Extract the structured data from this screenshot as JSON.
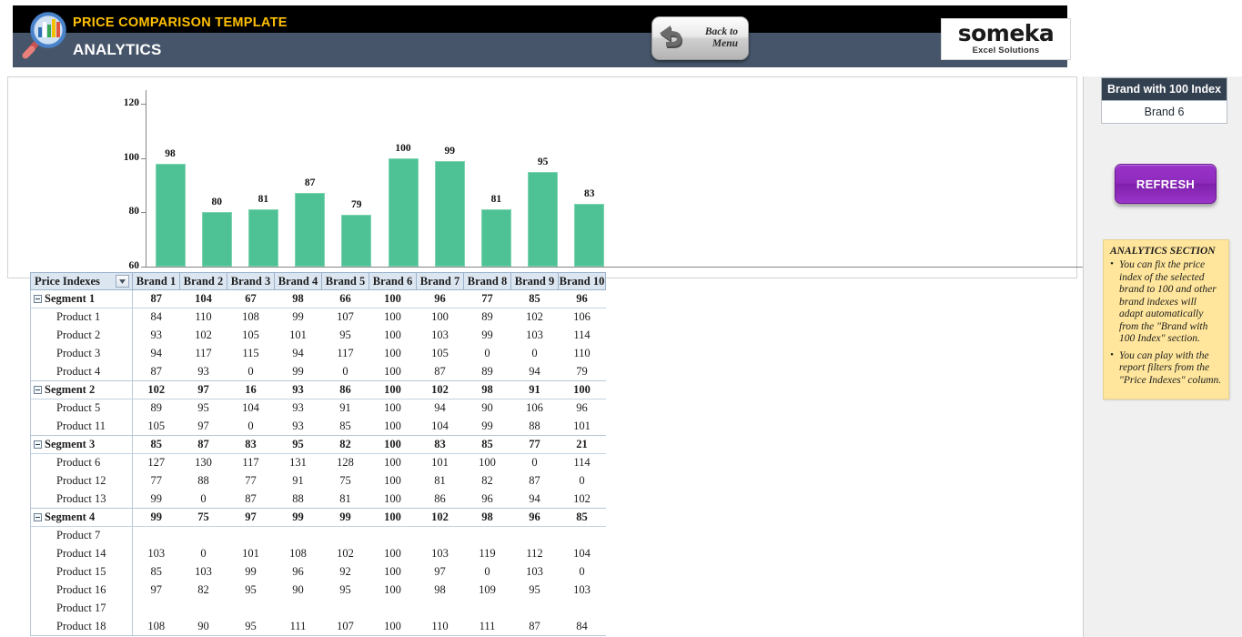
{
  "header": {
    "title": "PRICE COMPARISON TEMPLATE",
    "subtitle": "ANALYTICS",
    "back_button": {
      "line1": "Back to",
      "line2": "Menu"
    },
    "brand_logo": {
      "name": "someka",
      "tagline": "Excel Solutions"
    }
  },
  "chart_data": {
    "type": "bar",
    "title": "",
    "xlabel": "",
    "ylabel": "",
    "categories": [
      "Brand 1",
      "Brand 2",
      "Brand 3",
      "Brand 4",
      "Brand 5",
      "Brand 6",
      "Brand 7",
      "Brand 8",
      "Brand 9",
      "Brand 10"
    ],
    "values": [
      98,
      80,
      81,
      87,
      79,
      100,
      99,
      81,
      95,
      83
    ],
    "ylim": [
      60,
      125
    ],
    "yticks": [
      60,
      80,
      100,
      120
    ],
    "grid": false,
    "legend": false,
    "bar_color": "#4fc295"
  },
  "pivot": {
    "filter_header": "Price Indexes",
    "columns": [
      "Brand 1",
      "Brand 2",
      "Brand 3",
      "Brand 4",
      "Brand 5",
      "Brand 6",
      "Brand 7",
      "Brand 8",
      "Brand 9",
      "Brand 10"
    ],
    "rows": [
      {
        "type": "segment",
        "label": "Segment 1",
        "values": [
          87,
          104,
          67,
          98,
          66,
          100,
          96,
          77,
          85,
          96
        ]
      },
      {
        "type": "product",
        "label": "Product 1",
        "values": [
          84,
          110,
          108,
          99,
          107,
          100,
          100,
          89,
          102,
          106
        ]
      },
      {
        "type": "product",
        "label": "Product 2",
        "values": [
          93,
          102,
          105,
          101,
          95,
          100,
          103,
          99,
          103,
          114
        ]
      },
      {
        "type": "product",
        "label": "Product 3",
        "values": [
          94,
          117,
          115,
          94,
          117,
          100,
          105,
          0,
          0,
          110
        ]
      },
      {
        "type": "product",
        "label": "Product 4",
        "values": [
          87,
          93,
          0,
          99,
          0,
          100,
          87,
          89,
          94,
          79
        ]
      },
      {
        "type": "segment",
        "label": "Segment 2",
        "values": [
          102,
          97,
          16,
          93,
          86,
          100,
          102,
          98,
          91,
          100
        ]
      },
      {
        "type": "product",
        "label": "Product 5",
        "values": [
          89,
          95,
          104,
          93,
          91,
          100,
          94,
          90,
          106,
          96
        ]
      },
      {
        "type": "product",
        "label": "Product 11",
        "values": [
          105,
          97,
          0,
          93,
          85,
          100,
          104,
          99,
          88,
          101
        ]
      },
      {
        "type": "segment",
        "label": "Segment 3",
        "values": [
          85,
          87,
          83,
          95,
          82,
          100,
          83,
          85,
          77,
          21
        ]
      },
      {
        "type": "product",
        "label": "Product 6",
        "values": [
          127,
          130,
          117,
          131,
          128,
          100,
          101,
          100,
          0,
          114
        ]
      },
      {
        "type": "product",
        "label": "Product 12",
        "values": [
          77,
          88,
          77,
          91,
          75,
          100,
          81,
          82,
          87,
          0
        ]
      },
      {
        "type": "product",
        "label": "Product 13",
        "values": [
          99,
          0,
          87,
          88,
          81,
          100,
          86,
          96,
          94,
          102
        ]
      },
      {
        "type": "segment",
        "label": "Segment 4",
        "values": [
          99,
          75,
          97,
          99,
          99,
          100,
          102,
          98,
          96,
          85
        ]
      },
      {
        "type": "product",
        "label": "Product 7",
        "values": [
          "",
          "",
          "",
          "",
          "",
          "",
          "",
          "",
          "",
          ""
        ]
      },
      {
        "type": "product",
        "label": "Product 14",
        "values": [
          103,
          0,
          101,
          108,
          102,
          100,
          103,
          119,
          112,
          104
        ]
      },
      {
        "type": "product",
        "label": "Product 15",
        "values": [
          85,
          103,
          99,
          96,
          92,
          100,
          97,
          0,
          103,
          0
        ]
      },
      {
        "type": "product",
        "label": "Product 16",
        "values": [
          97,
          82,
          95,
          90,
          95,
          100,
          98,
          109,
          95,
          103
        ]
      },
      {
        "type": "product",
        "label": "Product 17",
        "values": [
          "",
          "",
          "",
          "",
          "",
          "",
          "",
          "",
          "",
          ""
        ]
      },
      {
        "type": "product",
        "label": "Product 18",
        "values": [
          108,
          90,
          95,
          111,
          107,
          100,
          110,
          111,
          87,
          84
        ]
      }
    ]
  },
  "right_panel": {
    "brand_index": {
      "header": "Brand with 100 Index",
      "value": "Brand 6"
    },
    "refresh_label": "REFRESH",
    "notes": {
      "title": "ANALYTICS SECTION",
      "items": [
        "You can fix the price index of the selected brand to 100 and other brand indexes will adapt automatically from the \"Brand with 100 Index\" section.",
        "You can play with the report filters from the \"Price Indexes\" column."
      ]
    }
  },
  "colors": {
    "header_black": "#000000",
    "header_slate": "#46556a",
    "title_yellow": "#ffc000",
    "bar_green": "#4fc295",
    "refresh_purple": "#9932c9",
    "note_yellow": "#ffe69c",
    "pivot_header_blue": "#dce6f1"
  }
}
